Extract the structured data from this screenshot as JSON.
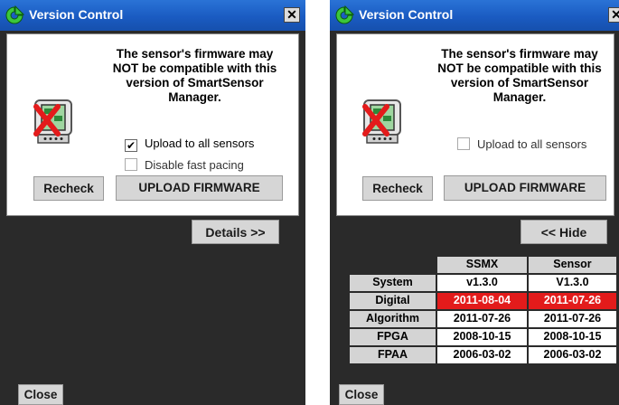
{
  "window_title": "Version Control",
  "close_glyph": "✕",
  "message": "The sensor's firmware may NOT be compatible with this version of SmartSensor Manager.",
  "upload_all_label": "Upload to all sensors",
  "check_glyph": "✔",
  "disable_pacing_label": "Disable fast pacing",
  "recheck_label": "Recheck",
  "upload_firmware_label": "UPLOAD FIRMWARE",
  "details_label": "Details >>",
  "hide_label": "<< Hide",
  "close_label": "Close",
  "left_window": {
    "upload_all_checked": true,
    "disable_pacing_checked": false
  },
  "right_window": {
    "upload_all_checked": false
  },
  "version_table": {
    "columns": [
      "SSMX",
      "Sensor"
    ],
    "rows": [
      {
        "label": "System",
        "ssmx": "v1.3.0",
        "sensor": "V1.3.0",
        "mismatch": false
      },
      {
        "label": "Digital",
        "ssmx": "2011-08-04",
        "sensor": "2011-07-26",
        "mismatch": true
      },
      {
        "label": "Algorithm",
        "ssmx": "2011-07-26",
        "sensor": "2011-07-26",
        "mismatch": false
      },
      {
        "label": "FPGA",
        "ssmx": "2008-10-15",
        "sensor": "2008-10-15",
        "mismatch": false
      },
      {
        "label": "FPAA",
        "ssmx": "2006-03-02",
        "sensor": "2006-03-02",
        "mismatch": false
      }
    ]
  },
  "colors": {
    "titlebar": "#1a5bc2",
    "mismatch": "#e31b1b",
    "window_bg": "#2a2a2a"
  },
  "icons": [
    "app-logo-icon",
    "close-icon",
    "device-error-icon",
    "checkbox-icon"
  ]
}
